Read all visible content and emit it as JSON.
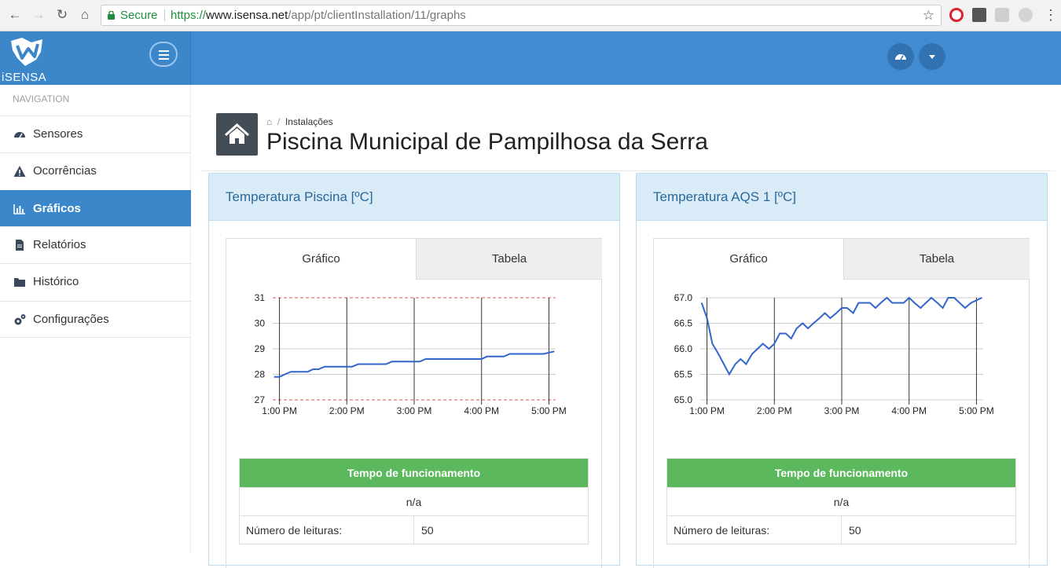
{
  "browser": {
    "secure_label": "Secure",
    "url_scheme": "https://",
    "url_host": "www.isensa.net",
    "url_path": "/app/pt/clientInstallation/11/graphs"
  },
  "app": {
    "logo_text": "iSENSA"
  },
  "sidebar": {
    "heading": "NAVIGATION",
    "items": [
      {
        "label": "Sensores",
        "icon": "dashboard-icon"
      },
      {
        "label": "Ocorrências",
        "icon": "warning-icon"
      },
      {
        "label": "Gráficos",
        "icon": "bar-chart-icon",
        "active": true
      },
      {
        "label": "Relatórios",
        "icon": "file-icon"
      },
      {
        "label": "Histórico",
        "icon": "folder-icon"
      },
      {
        "label": "Configurações",
        "icon": "gears-icon"
      }
    ]
  },
  "breadcrumb": {
    "item": "Instalações"
  },
  "page": {
    "title": "Piscina Municipal de Pampilhosa da Serra"
  },
  "panels": [
    {
      "title": "Temperatura Piscina [ºC]",
      "tab_graph": "Gráfico",
      "tab_table": "Tabela",
      "uptime_header": "Tempo de funcionamento",
      "uptime_value": "n/a",
      "readings_label": "Número de leituras:",
      "readings_value": "50"
    },
    {
      "title": "Temperatura AQS 1 [ºC]",
      "tab_graph": "Gráfico",
      "tab_table": "Tabela",
      "uptime_header": "Tempo de funcionamento",
      "uptime_value": "n/a",
      "readings_label": "Número de leituras:",
      "readings_value": "50"
    }
  ],
  "chart_data": [
    {
      "type": "line",
      "x_ticks": [
        "1:00 PM",
        "2:00 PM",
        "3:00 PM",
        "4:00 PM",
        "5:00 PM"
      ],
      "y_ticks": [
        "27",
        "28",
        "29",
        "30",
        "31"
      ],
      "ylim": [
        27,
        31
      ],
      "xlim_hours": [
        12.9,
        17.1
      ],
      "threshold_lines": [
        27,
        31
      ],
      "series_color": "#3366cc",
      "x": [
        12.92,
        13.0,
        13.08,
        13.17,
        13.25,
        13.33,
        13.42,
        13.5,
        13.58,
        13.67,
        13.75,
        13.83,
        13.92,
        14.0,
        14.08,
        14.17,
        14.25,
        14.33,
        14.42,
        14.5,
        14.58,
        14.67,
        14.75,
        14.83,
        14.92,
        15.0,
        15.08,
        15.17,
        15.25,
        15.33,
        15.42,
        15.5,
        15.58,
        15.67,
        15.75,
        15.83,
        15.92,
        16.0,
        16.08,
        16.17,
        16.25,
        16.33,
        16.42,
        16.5,
        16.58,
        16.67,
        16.75,
        16.83,
        16.92,
        17.08
      ],
      "y": [
        27.9,
        27.9,
        28.0,
        28.1,
        28.1,
        28.1,
        28.1,
        28.2,
        28.2,
        28.3,
        28.3,
        28.3,
        28.3,
        28.3,
        28.3,
        28.4,
        28.4,
        28.4,
        28.4,
        28.4,
        28.4,
        28.5,
        28.5,
        28.5,
        28.5,
        28.5,
        28.5,
        28.6,
        28.6,
        28.6,
        28.6,
        28.6,
        28.6,
        28.6,
        28.6,
        28.6,
        28.6,
        28.6,
        28.7,
        28.7,
        28.7,
        28.7,
        28.8,
        28.8,
        28.8,
        28.8,
        28.8,
        28.8,
        28.8,
        28.9
      ]
    },
    {
      "type": "line",
      "x_ticks": [
        "1:00 PM",
        "2:00 PM",
        "3:00 PM",
        "4:00 PM",
        "5:00 PM"
      ],
      "y_ticks": [
        "65.0",
        "65.5",
        "66.0",
        "66.5",
        "67.0"
      ],
      "ylim": [
        65.0,
        67.0
      ],
      "xlim_hours": [
        12.9,
        17.1
      ],
      "series_color": "#3366cc",
      "x": [
        12.92,
        13.0,
        13.08,
        13.17,
        13.25,
        13.33,
        13.42,
        13.5,
        13.58,
        13.67,
        13.75,
        13.83,
        13.92,
        14.0,
        14.08,
        14.17,
        14.25,
        14.33,
        14.42,
        14.5,
        14.58,
        14.67,
        14.75,
        14.83,
        14.92,
        15.0,
        15.08,
        15.17,
        15.25,
        15.33,
        15.42,
        15.5,
        15.58,
        15.67,
        15.75,
        15.83,
        15.92,
        16.0,
        16.08,
        16.17,
        16.25,
        16.33,
        16.42,
        16.5,
        16.58,
        16.67,
        16.75,
        16.83,
        16.92,
        17.08
      ],
      "y": [
        66.9,
        66.6,
        66.1,
        65.9,
        65.7,
        65.5,
        65.7,
        65.8,
        65.7,
        65.9,
        66.0,
        66.1,
        66.0,
        66.1,
        66.3,
        66.3,
        66.2,
        66.4,
        66.5,
        66.4,
        66.5,
        66.6,
        66.7,
        66.6,
        66.7,
        66.8,
        66.8,
        66.7,
        66.9,
        66.9,
        66.9,
        66.8,
        66.9,
        67.0,
        66.9,
        66.9,
        66.9,
        67.0,
        66.9,
        66.8,
        66.9,
        67.0,
        66.9,
        66.8,
        67.0,
        67.0,
        66.9,
        66.8,
        66.9,
        67.0
      ]
    }
  ]
}
